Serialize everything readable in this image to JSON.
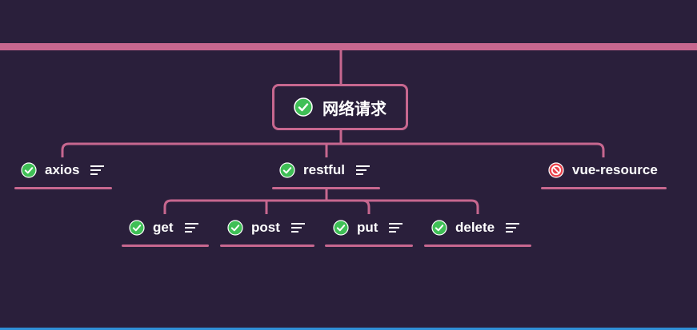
{
  "canvas": {
    "background": "#2a1f3b",
    "line_color": "#c7678f",
    "bottom_line_color": "#2f8fd6"
  },
  "mindmap": {
    "root": {
      "label": "网络请求",
      "status": "check-icon"
    },
    "nodes": {
      "axios": {
        "label": "axios",
        "status": "check-icon",
        "has_notes": true
      },
      "restful": {
        "label": "restful",
        "status": "check-icon",
        "has_notes": true
      },
      "vue_resource": {
        "label": "vue-resource",
        "status": "prohibited-icon",
        "has_notes": false
      },
      "get": {
        "label": "get",
        "status": "check-icon",
        "has_notes": true
      },
      "post": {
        "label": "post",
        "status": "check-icon",
        "has_notes": true
      },
      "put": {
        "label": "put",
        "status": "check-icon",
        "has_notes": true
      },
      "delete": {
        "label": "delete",
        "status": "check-icon",
        "has_notes": true
      }
    }
  }
}
